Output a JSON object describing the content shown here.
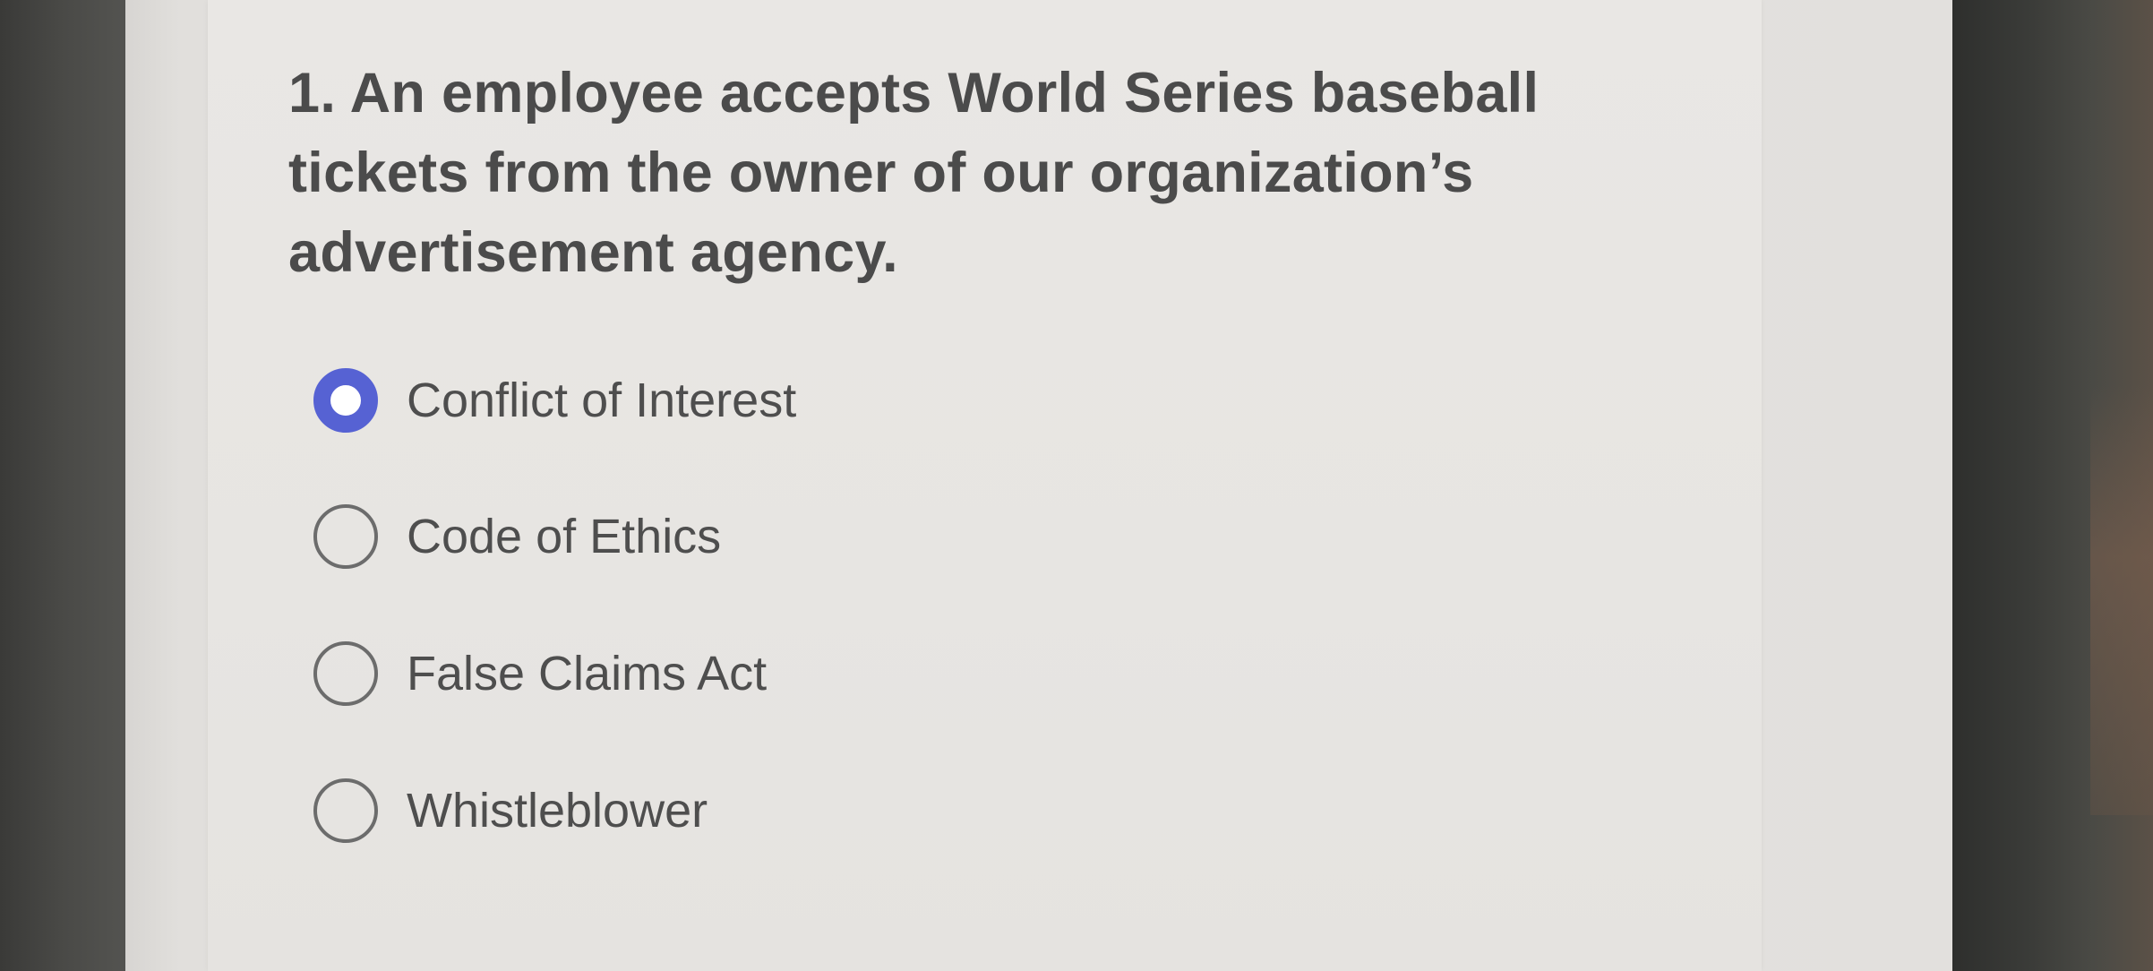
{
  "question": {
    "text": "1. An employee accepts World Series baseball tickets from the owner of our organization’s advertisement agency."
  },
  "options": [
    {
      "label": "Conflict of Interest",
      "selected": true
    },
    {
      "label": "Code of Ethics",
      "selected": false
    },
    {
      "label": "False Claims Act",
      "selected": false
    },
    {
      "label": "Whistleblower",
      "selected": false
    }
  ],
  "colors": {
    "accent": "#5662d3",
    "text": "#4b4b4b",
    "card_background": "#e7e5e2"
  }
}
